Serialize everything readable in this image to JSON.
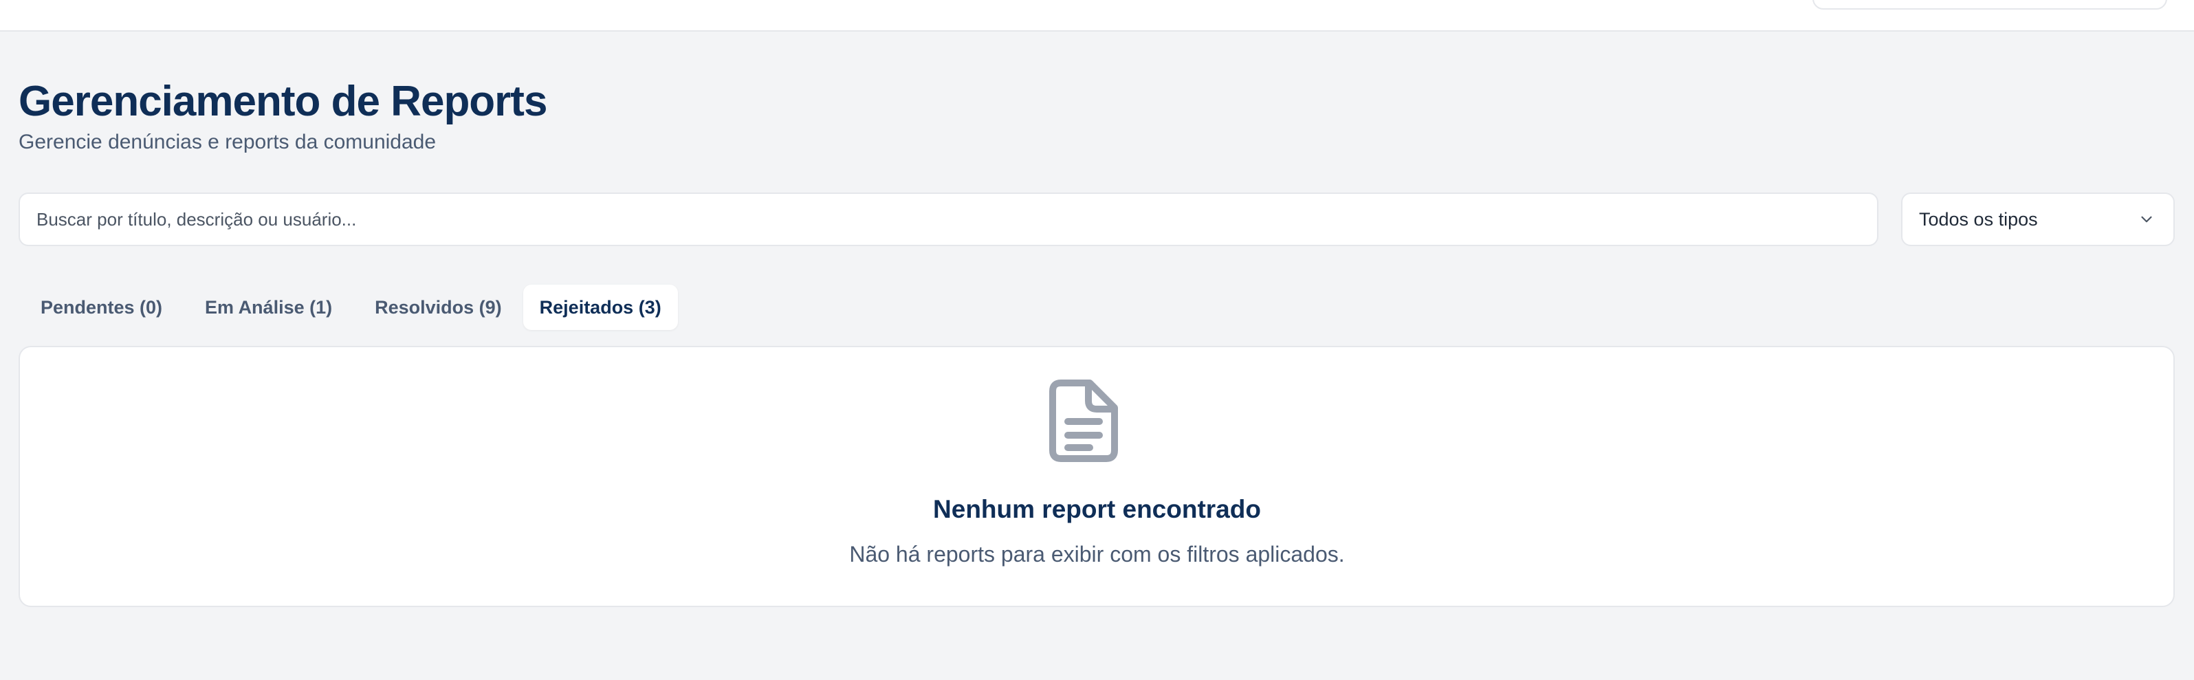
{
  "header": {
    "title": "Gerenciamento de Reports",
    "subtitle": "Gerencie denúncias e reports da comunidade"
  },
  "filters": {
    "search_placeholder": "Buscar por título, descrição ou usuário...",
    "type_selected": "Todos os tipos"
  },
  "tabs": [
    {
      "label": "Pendentes (0)",
      "active": false
    },
    {
      "label": "Em Análise (1)",
      "active": false
    },
    {
      "label": "Resolvidos (9)",
      "active": false
    },
    {
      "label": "Rejeitados (3)",
      "active": true
    }
  ],
  "empty_state": {
    "icon": "document-icon",
    "title": "Nenhum report encontrado",
    "message": "Não há reports para exibir com os filtros aplicados."
  },
  "colors": {
    "primary_text": "#0f2e57",
    "muted_text": "#4a5a72",
    "background": "#f3f4f6",
    "icon_gray": "#9ca3af"
  }
}
